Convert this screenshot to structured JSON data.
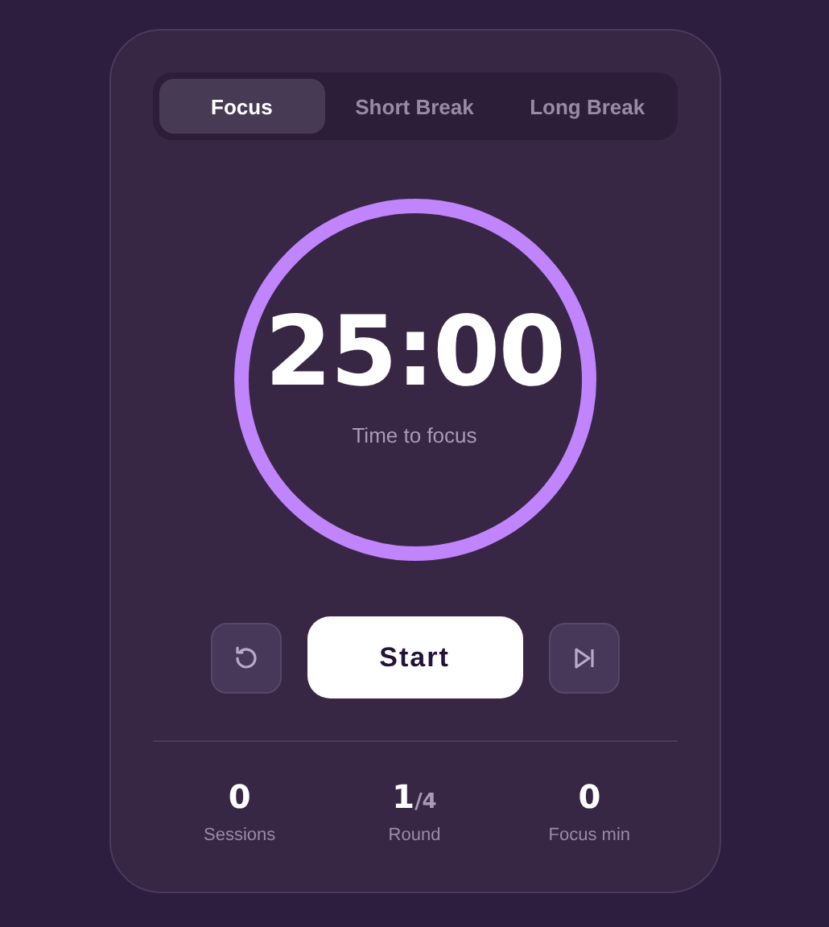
{
  "tabs": [
    {
      "label": "Focus",
      "selected": true
    },
    {
      "label": "Short Break",
      "selected": false
    },
    {
      "label": "Long Break",
      "selected": false
    }
  ],
  "timer": {
    "time": "25:00",
    "caption": "Time to focus",
    "level": 1
  },
  "controls": {
    "start_label": "Start"
  },
  "stats": [
    {
      "value": "0",
      "label": "Sessions"
    },
    {
      "value": "1",
      "suffix": "/4",
      "label": "Round"
    },
    {
      "value": "0",
      "label": "Focus min"
    }
  ]
}
